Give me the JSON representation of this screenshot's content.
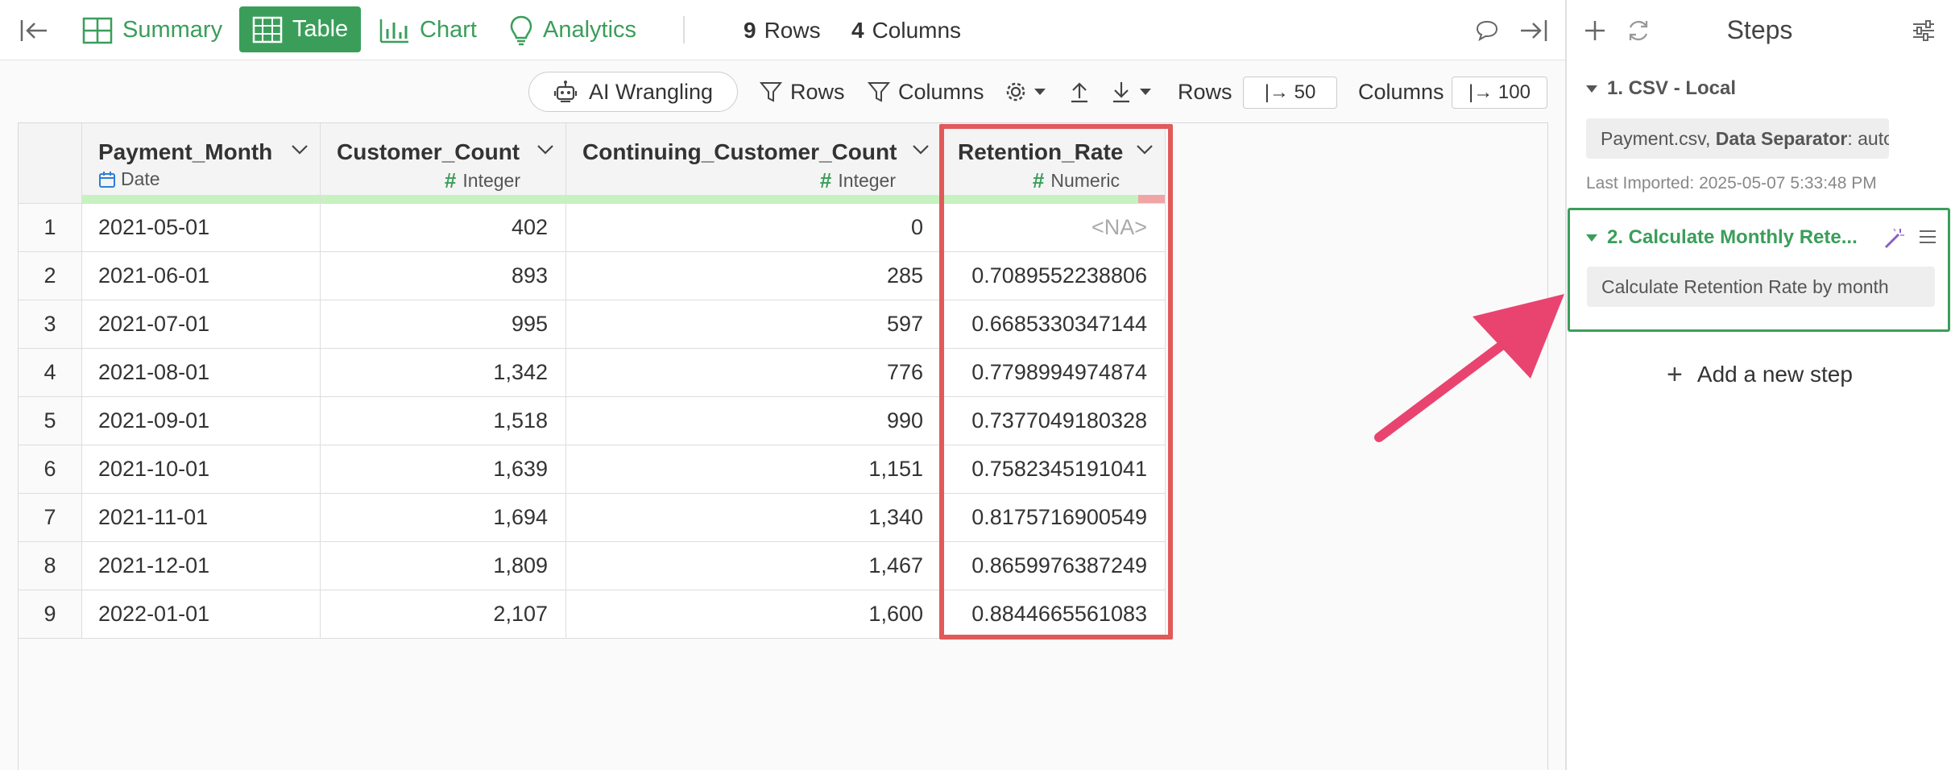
{
  "topbar": {
    "tabs": [
      {
        "label": "Summary",
        "icon": "summary-grid-icon"
      },
      {
        "label": "Table",
        "icon": "table-icon",
        "active": true
      },
      {
        "label": "Chart",
        "icon": "bar-chart-icon"
      },
      {
        "label": "Analytics",
        "icon": "lightbulb-icon"
      }
    ],
    "rows_count": "9",
    "rows_label": "Rows",
    "cols_count": "4",
    "cols_label": "Columns"
  },
  "toolbar": {
    "ai_label": "AI Wrangling",
    "rows_filter": "Rows",
    "columns_filter": "Columns",
    "rows_limit_label": "Rows",
    "rows_limit_value": "|→ 50",
    "cols_limit_label": "Columns",
    "cols_limit_value": "|→ 100"
  },
  "table": {
    "columns": [
      {
        "name": "Payment_Month",
        "type": "Date"
      },
      {
        "name": "Customer_Count",
        "type": "Integer"
      },
      {
        "name": "Continuing_Customer_Count",
        "type": "Integer"
      },
      {
        "name": "Retention_Rate",
        "type": "Numeric"
      }
    ],
    "rows": [
      {
        "idx": "1",
        "c0": "2021-05-01",
        "c1": "402",
        "c2": "0",
        "c3": "<NA>"
      },
      {
        "idx": "2",
        "c0": "2021-06-01",
        "c1": "893",
        "c2": "285",
        "c3": "0.7089552238806"
      },
      {
        "idx": "3",
        "c0": "2021-07-01",
        "c1": "995",
        "c2": "597",
        "c3": "0.6685330347144"
      },
      {
        "idx": "4",
        "c0": "2021-08-01",
        "c1": "1,342",
        "c2": "776",
        "c3": "0.7798994974874"
      },
      {
        "idx": "5",
        "c0": "2021-09-01",
        "c1": "1,518",
        "c2": "990",
        "c3": "0.7377049180328"
      },
      {
        "idx": "6",
        "c0": "2021-10-01",
        "c1": "1,639",
        "c2": "1,151",
        "c3": "0.7582345191041"
      },
      {
        "idx": "7",
        "c0": "2021-11-01",
        "c1": "1,694",
        "c2": "1,340",
        "c3": "0.8175716900549"
      },
      {
        "idx": "8",
        "c0": "2021-12-01",
        "c1": "1,809",
        "c2": "1,467",
        "c3": "0.8659976387249"
      },
      {
        "idx": "9",
        "c0": "2022-01-01",
        "c1": "2,107",
        "c2": "1,600",
        "c3": "0.8844665561083"
      }
    ]
  },
  "steps": {
    "title": "Steps",
    "step1": {
      "title": "1. CSV - Local",
      "file": "Payment.csv,",
      "sep_label": "Data Separator",
      "sep_value": ": auto",
      "meta": "Last Imported: 2025-05-07 5:33:48 PM"
    },
    "step2": {
      "title": "2. Calculate Monthly Rete...",
      "desc": "Calculate Retention Rate by month"
    },
    "add_label": "Add a new step"
  },
  "colors": {
    "accent": "#3a9e5a",
    "highlight": "#e05a5a",
    "arrow": "#e8446f"
  }
}
